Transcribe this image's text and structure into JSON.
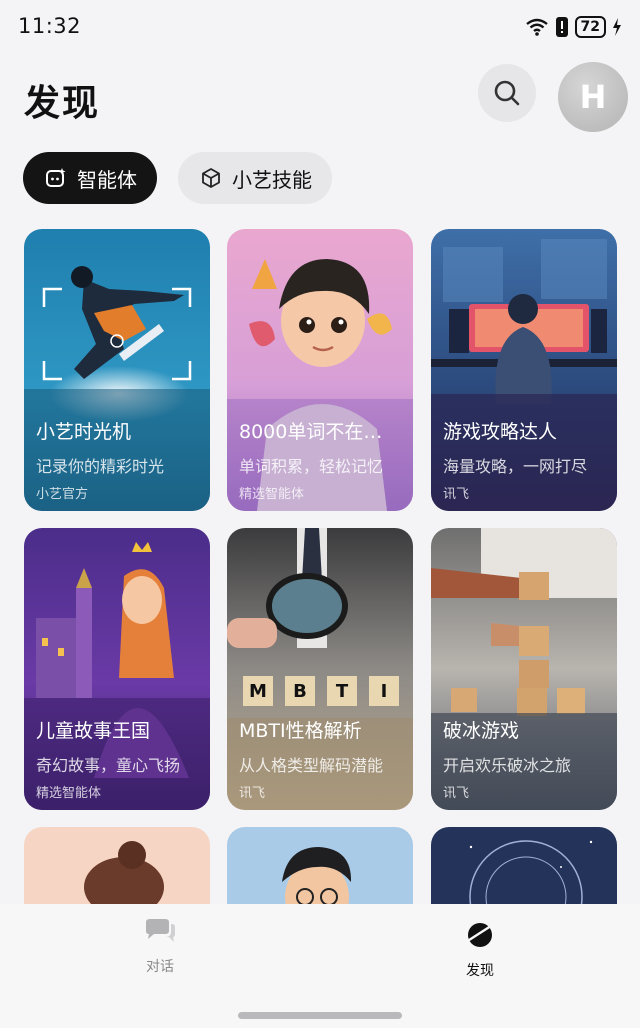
{
  "status_bar": {
    "time": "11:32",
    "battery": "72",
    "icons": [
      "wifi-icon",
      "alert-icon",
      "battery-icon",
      "charging-icon"
    ]
  },
  "header": {
    "title": "发现",
    "avatar_letter": "H"
  },
  "tabs": [
    {
      "label": "智能体",
      "icon": "agent-icon",
      "active": true
    },
    {
      "label": "小艺技能",
      "icon": "cube-icon",
      "active": false
    }
  ],
  "cards": [
    {
      "title": "小艺时光机",
      "description": "记录你的精彩时光",
      "source": "小艺官方"
    },
    {
      "title": "8000单词不在…",
      "description": "单词积累，轻松记忆",
      "source": "精选智能体"
    },
    {
      "title": "游戏攻略达人",
      "description": "海量攻略，一网打尽",
      "source": "讯飞"
    },
    {
      "title": "儿童故事王国",
      "description": "奇幻故事，童心飞扬",
      "source": "精选智能体"
    },
    {
      "title": "MBTI性格解析",
      "description": "从人格类型解码潜能",
      "source": "讯飞"
    },
    {
      "title": "破冰游戏",
      "description": "开启欢乐破冰之旅",
      "source": "讯飞"
    }
  ],
  "mbti_letters": [
    "M",
    "B",
    "T",
    "I"
  ],
  "bottom_nav": [
    {
      "label": "对话",
      "icon": "chat-icon",
      "active": false
    },
    {
      "label": "发现",
      "icon": "planet-icon",
      "active": true
    }
  ],
  "colors": {
    "active_tab": "#141414",
    "inactive_tab": "#e7e7e9",
    "background": "#f4f4f6"
  }
}
